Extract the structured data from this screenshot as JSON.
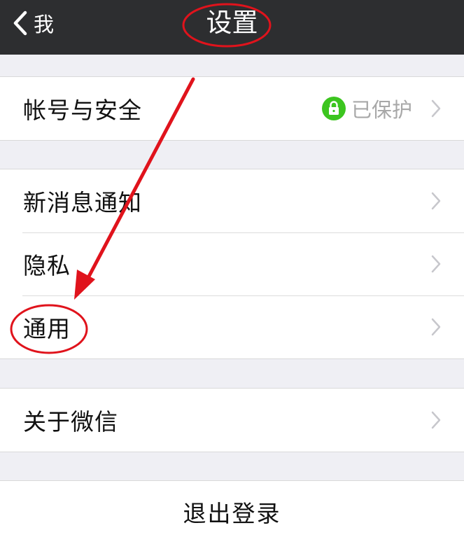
{
  "navbar": {
    "back_label": "我",
    "title": "设置"
  },
  "groups": [
    {
      "rows": [
        {
          "label": "帐号与安全",
          "value": "已保护"
        }
      ]
    },
    {
      "rows": [
        {
          "label": "新消息通知"
        },
        {
          "label": "隐私"
        },
        {
          "label": "通用"
        }
      ]
    },
    {
      "rows": [
        {
          "label": "关于微信"
        }
      ]
    }
  ],
  "logout_label": "退出登录",
  "icons": {
    "back": "chevron-left-icon",
    "lock": "lock-icon",
    "row_arrow": "chevron-right-icon"
  },
  "colors": {
    "navbar_bg": "#2d2e30",
    "page_bg": "#efeff4",
    "lock_green": "#3cc51f",
    "annotation_red": "#e0131c"
  }
}
